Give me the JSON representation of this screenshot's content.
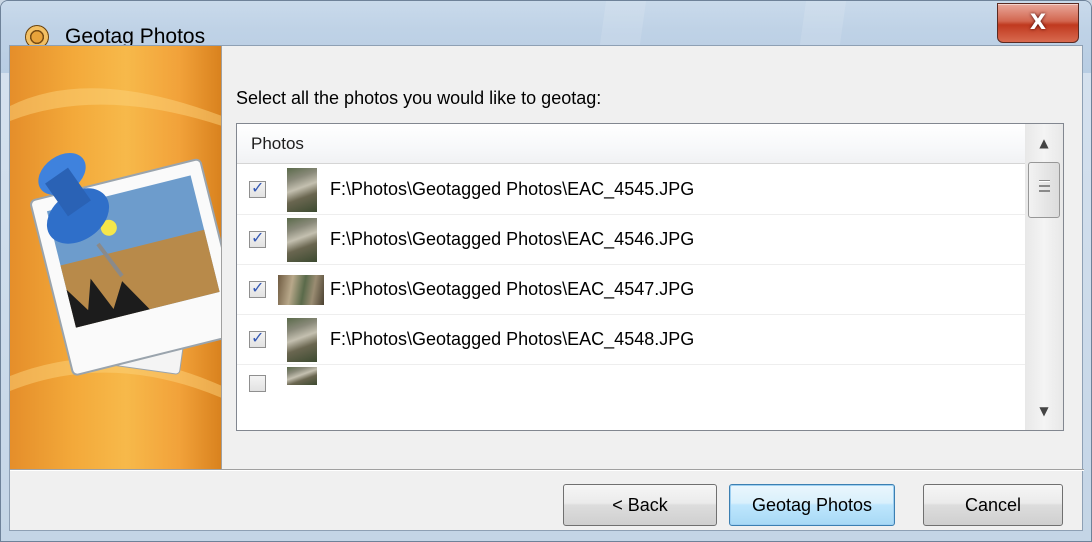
{
  "window": {
    "title": "Geotag Photos",
    "icon": "app-globe-icon",
    "close_label": "X"
  },
  "main": {
    "instruction": "Select all the photos you would like to geotag:",
    "list": {
      "column_header": "Photos",
      "rows": [
        {
          "path": "F:\\Photos\\Geotagged Photos\\EAC_4545.JPG",
          "checked": true,
          "thumb": "portrait"
        },
        {
          "path": "F:\\Photos\\Geotagged Photos\\EAC_4546.JPG",
          "checked": true,
          "thumb": "portrait"
        },
        {
          "path": "F:\\Photos\\Geotagged Photos\\EAC_4547.JPG",
          "checked": true,
          "thumb": "landscape"
        },
        {
          "path": "F:\\Photos\\Geotagged Photos\\EAC_4548.JPG",
          "checked": true,
          "thumb": "portrait"
        }
      ]
    }
  },
  "buttons": {
    "back": "< Back",
    "geotag": "Geotag Photos",
    "cancel": "Cancel"
  },
  "colors": {
    "banner_orange": "#f3a93a",
    "close_red": "#c0391f",
    "check_blue": "#3357b4"
  }
}
